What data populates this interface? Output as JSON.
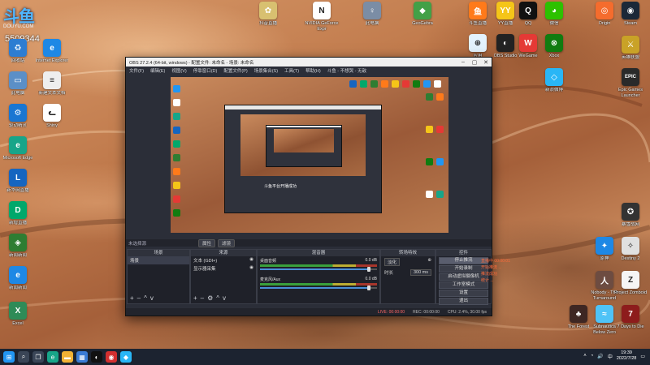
{
  "brand": {
    "logo": "斗鱼",
    "sub": "DOUYU.COM",
    "room_id": "5509344"
  },
  "desktop_icons_left": [
    {
      "label": "回收站",
      "icon": "recycle-bin-icon",
      "color": "#2d7dd2",
      "glyph": "♻"
    },
    {
      "label": "Internet Explorer",
      "icon": "ie-icon",
      "color": "#1e88e5",
      "glyph": "e"
    },
    {
      "label": "此电脑",
      "icon": "computer-icon",
      "color": "#5b8fc7",
      "glyph": "▭"
    },
    {
      "label": "新建文本文档",
      "icon": "text-doc-icon",
      "color": "#eeeeee",
      "glyph": "≡"
    },
    {
      "label": "驱动精灵",
      "icon": "driver-icon",
      "color": "#1976d2",
      "glyph": "⚙"
    },
    {
      "label": "Shiny",
      "icon": "cat-icon",
      "color": "#ffffff",
      "glyph": "ᓚ"
    },
    {
      "label": "Microsoft Edge",
      "icon": "edge-icon",
      "color": "#17a589",
      "glyph": "e"
    },
    {
      "label": "新华网直播",
      "icon": "app-icon",
      "color": "#1565c0",
      "glyph": "L"
    },
    {
      "label": "新增直播",
      "icon": "app-icon",
      "color": "#00a86b",
      "glyph": "D"
    },
    {
      "label": "新闻新闻",
      "icon": "app-icon",
      "color": "#2e7d32",
      "glyph": "◈"
    },
    {
      "label": "新闻新闻",
      "icon": "app-icon",
      "color": "#1e88e5",
      "glyph": "e"
    },
    {
      "label": "Excel",
      "icon": "excel-icon",
      "color": "#2e8b57",
      "glyph": "X"
    }
  ],
  "desktop_icons_top": [
    {
      "label": "抖音直播",
      "icon": "app-icon",
      "color": "#d8c070",
      "glyph": "✿"
    },
    {
      "label": "NVIDIA GeForce Expr",
      "icon": "nvidia-icon",
      "color": "#ffffff",
      "glyph": "N"
    },
    {
      "label": "此电脑",
      "icon": "tool-icon",
      "color": "#7b8da5",
      "glyph": "♀"
    },
    {
      "label": "GeoGebra",
      "icon": "app-icon",
      "color": "#43a047",
      "glyph": "◆"
    },
    {
      "label": "斗鱼直播",
      "icon": "app-icon",
      "color": "#ff7a1a",
      "glyph": "鱼"
    },
    {
      "label": "YY直播",
      "icon": "yy-icon",
      "color": "#f5c518",
      "glyph": "YY"
    },
    {
      "label": "QQ",
      "icon": "qq-icon",
      "color": "#111111",
      "glyph": "Q"
    },
    {
      "label": "微信",
      "icon": "wechat-icon",
      "color": "#2dc100",
      "glyph": "◕"
    },
    {
      "label": "Origin",
      "icon": "origin-icon",
      "color": "#f56c2d",
      "glyph": "◎"
    },
    {
      "label": "Steam",
      "icon": "steam-icon",
      "color": "#1b2838",
      "glyph": "◉"
    }
  ],
  "desktop_icons_right": [
    {
      "label": "应用",
      "icon": "app-icon",
      "color": "#e3f2fd",
      "glyph": "⊕"
    },
    {
      "label": "OBS Studio",
      "icon": "obs-icon",
      "color": "#222222",
      "glyph": "◐"
    },
    {
      "label": "WeGame",
      "icon": "wegame-icon",
      "color": "#e53935",
      "glyph": "W"
    },
    {
      "label": "Xbox",
      "icon": "xbox-icon",
      "color": "#107c10",
      "glyph": "⊗"
    },
    {
      "label": "Epic Games Launcher",
      "icon": "epic-icon",
      "color": "#2a2a2a",
      "glyph": "EPIC"
    },
    {
      "label": "英雄联盟",
      "icon": "game-icon",
      "color": "#c9a227",
      "glyph": "⚔"
    },
    {
      "label": "原神",
      "icon": "game-icon",
      "color": "#1e88e5",
      "glyph": "✦"
    },
    {
      "label": "新浪微博",
      "icon": "app-icon",
      "color": "#29b6f6",
      "glyph": "◇"
    },
    {
      "label": "Nobody - The Turnaround",
      "icon": "game-icon",
      "color": "#6d4c41",
      "glyph": "人"
    },
    {
      "label": "Project Zomboid",
      "icon": "game-icon",
      "color": "#f5f5f5",
      "glyph": "Z"
    },
    {
      "label": "The Forest",
      "icon": "game-icon",
      "color": "#3e2723",
      "glyph": "♣"
    },
    {
      "label": "Subnautica Below Zero",
      "icon": "game-icon",
      "color": "#4fc3f7",
      "glyph": "≈"
    },
    {
      "label": "7 Days to Die",
      "icon": "game-icon",
      "color": "#8d1c1c",
      "glyph": "7"
    },
    {
      "label": "Destiny 2",
      "icon": "destiny-icon",
      "color": "#e0e0e0",
      "glyph": "✧"
    },
    {
      "label": "暴雪战网",
      "icon": "app-icon",
      "color": "#333333",
      "glyph": "✪"
    }
  ],
  "obs": {
    "title": "OBS 27.2.4 (64-bit, windows) - 配置文件: 未命名 - 场景: 未命名",
    "menus": [
      "文件(F)",
      "编辑(E)",
      "视图(V)",
      "停靠窗口(D)",
      "配置文件(P)",
      "场景集合(S)",
      "工具(T)",
      "帮助(H)",
      "斗鱼 - 不想哭 - 无敌"
    ],
    "scene_label": "未选择源",
    "prop_button": "属性",
    "filter_button": "滤镜",
    "nested_caption": "斗鱼平台开播成功",
    "docks": {
      "scenes": {
        "title": "场景",
        "items": [
          "场景"
        ]
      },
      "sources": {
        "title": "来源",
        "items": [
          "文本 (GDI+)",
          "显示器采集"
        ]
      },
      "mixer": {
        "title": "混音器",
        "channels": [
          {
            "name": "桌面音频",
            "db": "0.0 dB"
          },
          {
            "name": "麦克风/Aux",
            "db": "0.0 dB"
          }
        ]
      },
      "transitions": {
        "title": "转场特效",
        "type": "淡化",
        "duration_label": "时长",
        "duration": "300 ms"
      },
      "controls": {
        "title": "控件",
        "buttons": [
          "停止推流",
          "开始录制",
          "启动虚拟摄像机",
          "工作室模式",
          "设置",
          "退出"
        ]
      }
    },
    "status": {
      "live": "LIVE: 00:00:00",
      "rec": "REC: 00:00:00",
      "cpu": "CPU: 2.4%, 30.00 fps"
    },
    "log_lines": [
      "直播中 00:00:01",
      "开始推流 ...",
      "推流成功",
      "统计 ..."
    ]
  },
  "taskbar": {
    "apps": [
      {
        "icon": "windows-start-icon",
        "color": "#2196f3",
        "glyph": "⊞"
      },
      {
        "icon": "search-icon",
        "color": "#3a4556",
        "glyph": "⌕"
      },
      {
        "icon": "task-view-icon",
        "color": "#3a4556",
        "glyph": "❐"
      },
      {
        "icon": "edge-icon",
        "color": "#17a589",
        "glyph": "e"
      },
      {
        "icon": "explorer-icon",
        "color": "#f2b134",
        "glyph": "▬"
      },
      {
        "icon": "store-icon",
        "color": "#3a7bd5",
        "glyph": "▦"
      },
      {
        "icon": "obs-icon",
        "color": "#111111",
        "glyph": "◐"
      },
      {
        "icon": "app-icon",
        "color": "#d32f2f",
        "glyph": "◉"
      },
      {
        "icon": "app-icon",
        "color": "#29b6f6",
        "glyph": "◆"
      }
    ],
    "tray": {
      "lang": "中",
      "time": "19:39",
      "date": "2022/7/28"
    }
  }
}
